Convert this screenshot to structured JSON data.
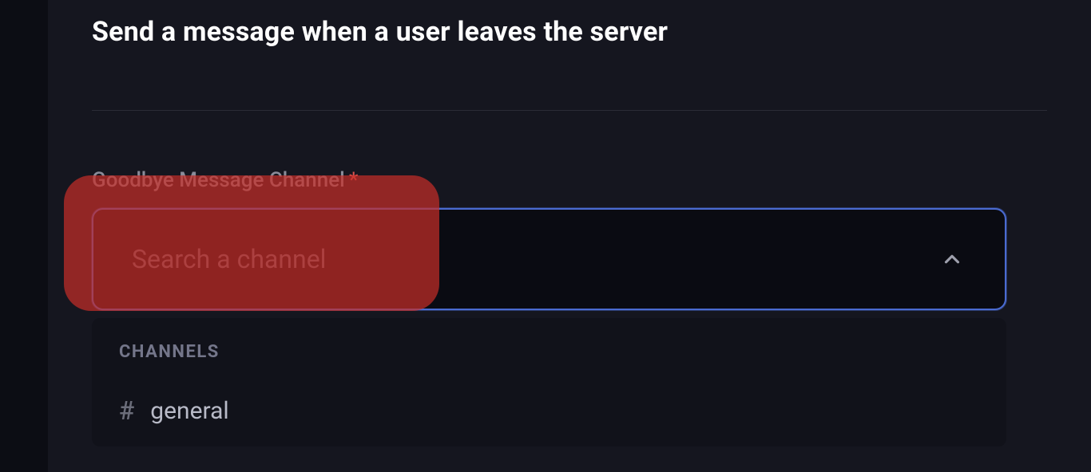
{
  "section": {
    "title": "Send a message when a user leaves the server"
  },
  "field": {
    "label": "Goodbye Message Channel",
    "required_mark": "*",
    "placeholder": "Search a channel"
  },
  "dropdown": {
    "group_label": "CHANNELS",
    "items": [
      {
        "icon": "#",
        "name": "general"
      }
    ]
  }
}
